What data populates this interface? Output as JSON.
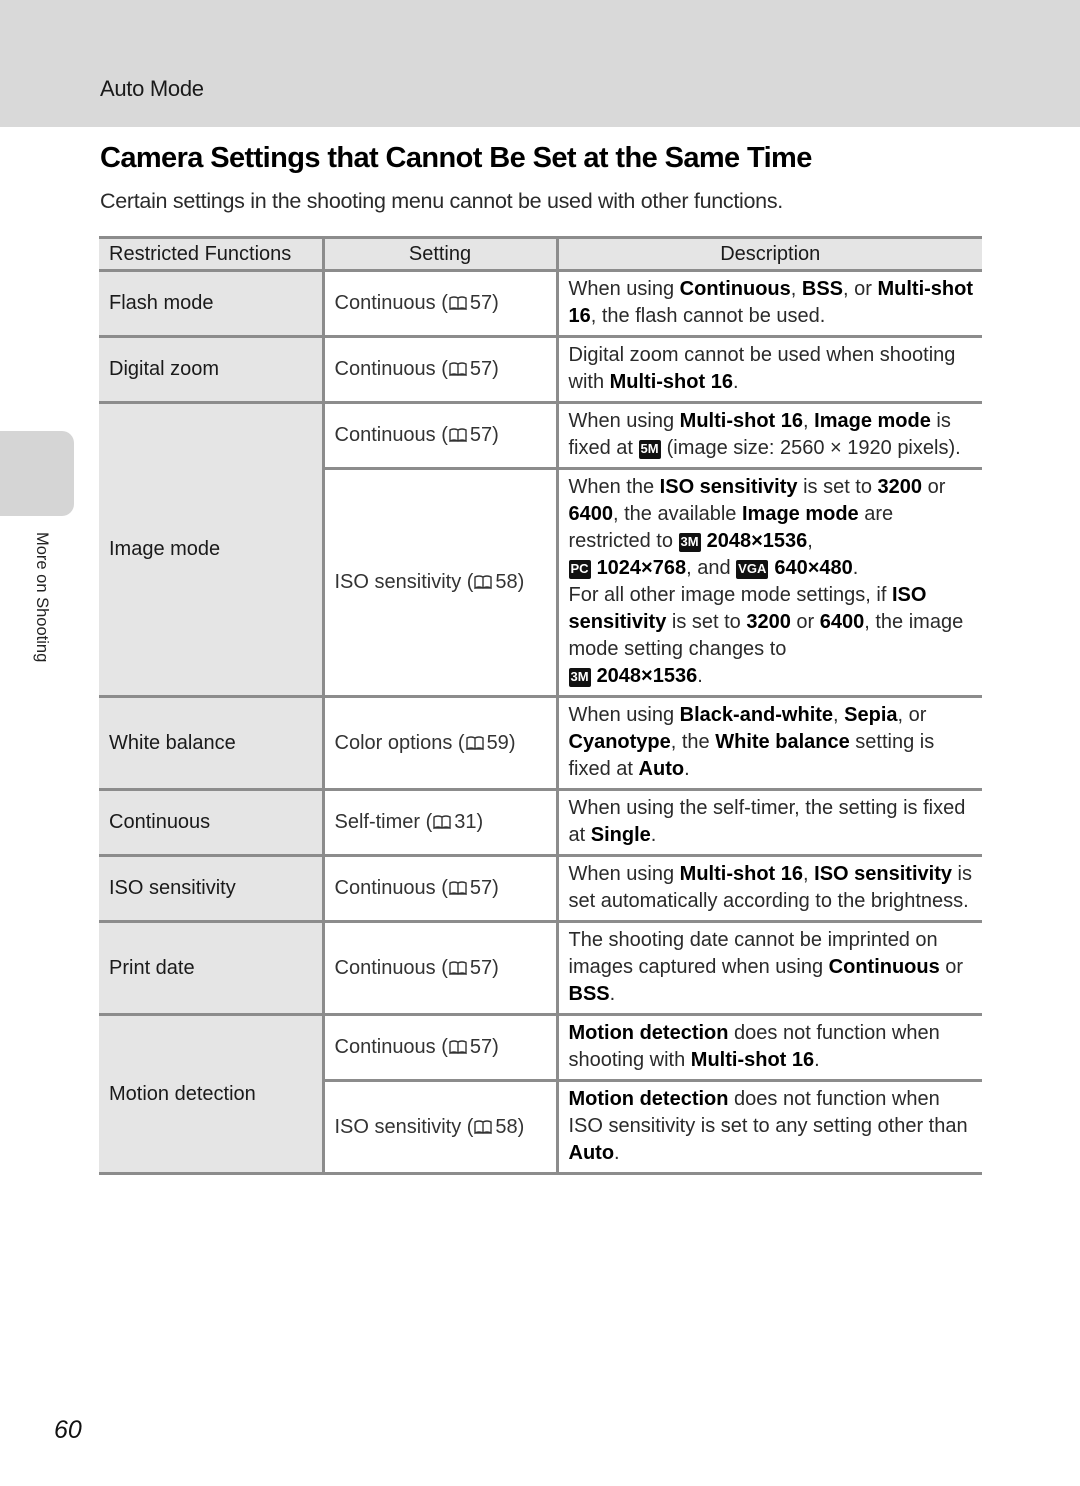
{
  "header": {
    "section": "Auto Mode",
    "title": "Camera Settings that Cannot Be Set at the Same Time",
    "intro": "Certain settings in the shooting menu cannot be used with other functions."
  },
  "side_tab": {
    "label": "More on Shooting"
  },
  "page_number": "60",
  "table": {
    "headers": [
      "Restricted Functions",
      "Setting",
      "Description"
    ],
    "rows": [
      {
        "function": "Flash mode",
        "settings": [
          {
            "setting": "Continuous",
            "page": "57",
            "description": [
              [
                "When using "
              ],
              [
                "Continuous",
                "b"
              ],
              [
                ", "
              ],
              [
                "BSS",
                "b"
              ],
              [
                ", or "
              ],
              [
                "Multi-shot 16",
                "b"
              ],
              [
                ", the flash cannot be used."
              ]
            ]
          }
        ]
      },
      {
        "function": "Digital zoom",
        "settings": [
          {
            "setting": "Continuous",
            "page": "57",
            "description": [
              [
                "Digital zoom cannot be used when shooting with "
              ],
              [
                "Multi-shot 16",
                "b"
              ],
              [
                "."
              ]
            ]
          }
        ]
      },
      {
        "function": "Image mode",
        "settings": [
          {
            "setting": "Continuous",
            "page": "57",
            "description": [
              [
                "When using "
              ],
              [
                "Multi-shot 16",
                "b"
              ],
              [
                ", "
              ],
              [
                "Image mode",
                "b"
              ],
              [
                " is fixed at "
              ],
              [
                "5M",
                "icon"
              ],
              [
                "(image size: 2560 × 1920 pixels)."
              ]
            ]
          },
          {
            "setting": "ISO sensitivity",
            "page": "58",
            "description": [
              [
                "When the "
              ],
              [
                "ISO sensitivity",
                "b"
              ],
              [
                " is set to "
              ],
              [
                "3200",
                "b"
              ],
              [
                " or "
              ],
              [
                "6400",
                "b"
              ],
              [
                ", the available "
              ],
              [
                "Image mode",
                "b"
              ],
              [
                " are restricted to "
              ],
              [
                "3M",
                "icon"
              ],
              [
                "2048×1536",
                "b"
              ],
              [
                ", "
              ],
              [
                "br"
              ],
              [
                "PC",
                "icon"
              ],
              [
                "1024×768",
                "b"
              ],
              [
                ", and "
              ],
              [
                "VGA",
                "icon"
              ],
              [
                "640×480",
                "b"
              ],
              [
                "."
              ],
              [
                "br"
              ],
              [
                "For all other image mode settings, if "
              ],
              [
                "ISO sensitivity",
                "b"
              ],
              [
                " is set to "
              ],
              [
                "3200",
                "b"
              ],
              [
                " or "
              ],
              [
                "6400",
                "b"
              ],
              [
                ", the image mode setting changes to "
              ],
              [
                "br"
              ],
              [
                "3M",
                "icon"
              ],
              [
                "2048×1536",
                "b"
              ],
              [
                "."
              ]
            ]
          }
        ]
      },
      {
        "function": "White balance",
        "settings": [
          {
            "setting": "Color options",
            "page": "59",
            "description": [
              [
                "When using "
              ],
              [
                "Black-and-white",
                "b"
              ],
              [
                ", "
              ],
              [
                "Sepia",
                "b"
              ],
              [
                ", or "
              ],
              [
                "Cyanotype",
                "b"
              ],
              [
                ", the "
              ],
              [
                "White balance",
                "b"
              ],
              [
                " setting is fixed at "
              ],
              [
                "Auto",
                "b"
              ],
              [
                "."
              ]
            ]
          }
        ]
      },
      {
        "function": "Continuous",
        "settings": [
          {
            "setting": "Self-timer",
            "page": "31",
            "description": [
              [
                "When using the self-timer, the setting is fixed at "
              ],
              [
                "Single",
                "b"
              ],
              [
                "."
              ]
            ]
          }
        ]
      },
      {
        "function": "ISO sensitivity",
        "settings": [
          {
            "setting": "Continuous",
            "page": "57",
            "description": [
              [
                "When using "
              ],
              [
                "Multi-shot 16",
                "b"
              ],
              [
                ", "
              ],
              [
                "ISO sensitivity",
                "b"
              ],
              [
                " is set automatically according to the brightness."
              ]
            ]
          }
        ]
      },
      {
        "function": "Print date",
        "settings": [
          {
            "setting": "Continuous",
            "page": "57",
            "description": [
              [
                "The shooting date cannot be imprinted on images captured when using "
              ],
              [
                "Continuous",
                "b"
              ],
              [
                " or "
              ],
              [
                "BSS",
                "b"
              ],
              [
                "."
              ]
            ]
          }
        ]
      },
      {
        "function": "Motion detection",
        "settings": [
          {
            "setting": "Continuous",
            "page": "57",
            "description": [
              [
                "Motion detection",
                "b"
              ],
              [
                " does not function when shooting with "
              ],
              [
                "Multi-shot 16",
                "b"
              ],
              [
                "."
              ]
            ]
          },
          {
            "setting": "ISO sensitivity",
            "page": "58",
            "description": [
              [
                "Motion detection",
                "b"
              ],
              [
                " does not function when ISO sensitivity is set to any setting other than "
              ],
              [
                "Auto",
                "b"
              ],
              [
                "."
              ]
            ]
          }
        ]
      }
    ]
  },
  "icons": {
    "page_reference": "book-icon",
    "image_sizes": [
      "5M",
      "3M",
      "PC",
      "VGA"
    ]
  }
}
